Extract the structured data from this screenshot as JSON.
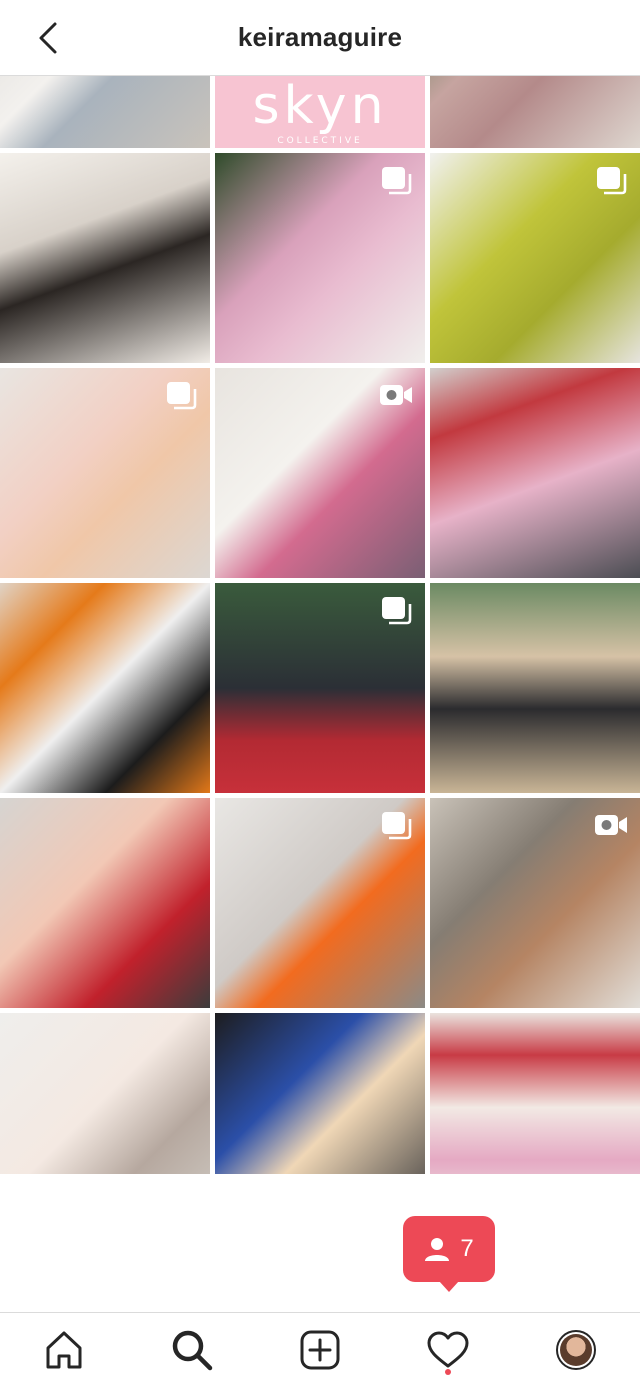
{
  "header": {
    "username": "keiramaguire"
  },
  "posts": [
    {
      "bg": "linear-gradient(135deg,#d9d7d4 0%,#f3f1ee 45%,#a9b3bd 60%,#c9c3bb 100%)",
      "badge": "none"
    },
    {
      "bg": "#f7c4d2",
      "badge": "none",
      "brand": "skyn",
      "brand_sub": "COLLECTIVE"
    },
    {
      "bg": "linear-gradient(135deg,#3f6d3d 0%,#c6a4a0 40%,#b48a8a 60%,#ded6cf 100%)",
      "badge": "none"
    },
    {
      "bg": "linear-gradient(160deg,#f4f1ec 0%,#d8d1c9 35%,#2b2623 55%,#f1ece6 100%)",
      "badge": "none"
    },
    {
      "bg": "linear-gradient(135deg,#2f4b2a 0%,#d9a1bb 40%,#e9bcd0 60%,#f0efec 100%)",
      "badge": "carousel"
    },
    {
      "bg": "linear-gradient(135deg,#f1f1ef 0%,#c0c43a 40%,#a5ab2e 65%,#e6e4de 100%)",
      "badge": "carousel"
    },
    {
      "bg": "linear-gradient(135deg,#e9e5e1 0%,#f2d0c4 40%,#f0c7a8 60%,#dcd7d2 100%)",
      "badge": "carousel"
    },
    {
      "bg": "linear-gradient(135deg,#e8e4df 0%,#f4f2ee 40%,#d36b8f 60%,#7a5f74 100%)",
      "badge": "video"
    },
    {
      "bg": "linear-gradient(160deg,#d2cfcd 0%,#c2393f 25%,#e7b2c8 55%,#4b4d53 100%)",
      "badge": "none"
    },
    {
      "bg": "linear-gradient(135deg,#e0d3c6 0%,#e57a1a 25%,#efefef 50%,#1c1c1c 75%,#e27819 100%)",
      "badge": "none"
    },
    {
      "bg": "linear-gradient(180deg,#3a5b3c 0%,#2b2f36 50%,#b32a33 75%,#c7303a 100%)",
      "badge": "carousel"
    },
    {
      "bg": "linear-gradient(180deg,#6b8a63 0%,#d6c2a6 35%,#2b2b2e 60%,#c9b596 100%)",
      "badge": "none"
    },
    {
      "bg": "linear-gradient(135deg,#d6d4d1 0%,#f2c8b5 40%,#c1212c 70%,#3c3c3c 100%)",
      "badge": "none"
    },
    {
      "bg": "linear-gradient(135deg,#e9e7e4 0%,#cfcac6 45%,#f26b1f 60%,#8c8a86 100%)",
      "badge": "carousel"
    },
    {
      "bg": "linear-gradient(135deg,#c9c2b8 0%,#857d73 35%,#b58463 60%,#e2ded8 100%)",
      "badge": "video"
    },
    {
      "bg": "linear-gradient(135deg,#efeeec 0%,#f4e9e2 45%,#b6a89f 70%,#cfcac3 100%)",
      "badge": "none"
    },
    {
      "bg": "linear-gradient(135deg,#1d1d1f 0%,#2b4fa8 35%,#f0d7b6 55%,#3a3a3c 100%)",
      "badge": "none"
    },
    {
      "bg": "linear-gradient(180deg,#eae3de 0%,#c83b45 20%,#f2e9e4 45%,#e5a9c3 70%,#f1eeea 100%)",
      "badge": "none"
    },
    {
      "bg": "linear-gradient(180deg,#d1ccc7 0%,#8b857f 100%)",
      "badge": "none"
    },
    {
      "bg": "linear-gradient(180deg,#e3e1de 0%,#b8b3ad 100%)",
      "badge": "none"
    },
    {
      "bg": "linear-gradient(180deg,#c4b2a8 0%,#9a8a80 100%)",
      "badge": "none"
    }
  ],
  "activity": {
    "count": "7"
  },
  "tabs": [
    {
      "name": "home"
    },
    {
      "name": "search"
    },
    {
      "name": "new-post"
    },
    {
      "name": "activity"
    },
    {
      "name": "profile"
    }
  ]
}
